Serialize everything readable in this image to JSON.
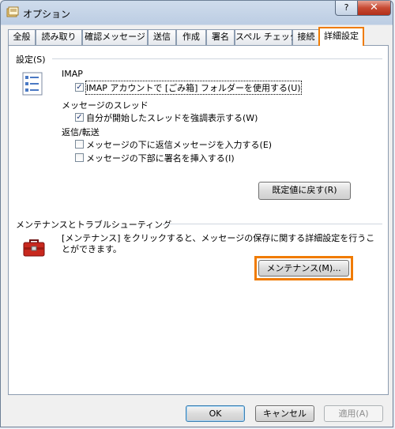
{
  "window": {
    "title": "オプション"
  },
  "titlebar_buttons": {
    "help": "?",
    "close": "✕"
  },
  "tabs": [
    "全般",
    "読み取り",
    "確認メッセージ",
    "送信",
    "作成",
    "署名",
    "スペル チェック",
    "接続",
    "詳細設定"
  ],
  "settings": {
    "section_title": "設定(S)",
    "imap_heading": "IMAP",
    "imap_checkbox": {
      "label": "IMAP アカウントで [ごみ箱] フォルダーを使用する(U)",
      "checked": true
    },
    "thread_heading": "メッセージのスレッド",
    "thread_checkbox": {
      "label": "自分が開始したスレッドを強調表示する(W)",
      "checked": true
    },
    "reply_heading": "返信/転送",
    "reply_below": {
      "label": "メッセージの下に返信メッセージを入力する(E)",
      "checked": false
    },
    "signature_bottom": {
      "label": "メッセージの下部に署名を挿入する(I)",
      "checked": false
    },
    "restore_button": "既定値に戻す(R)"
  },
  "maintenance": {
    "section_title": "メンテナンスとトラブルシューティング",
    "description": "[メンテナンス] をクリックすると、メッセージの保存に関する詳細設定を行うことができます。",
    "button": "メンテナンス(M)..."
  },
  "footer": {
    "ok": "OK",
    "cancel": "キャンセル",
    "apply": "適用(A)"
  },
  "colors": {
    "highlight": "#f07b00"
  }
}
